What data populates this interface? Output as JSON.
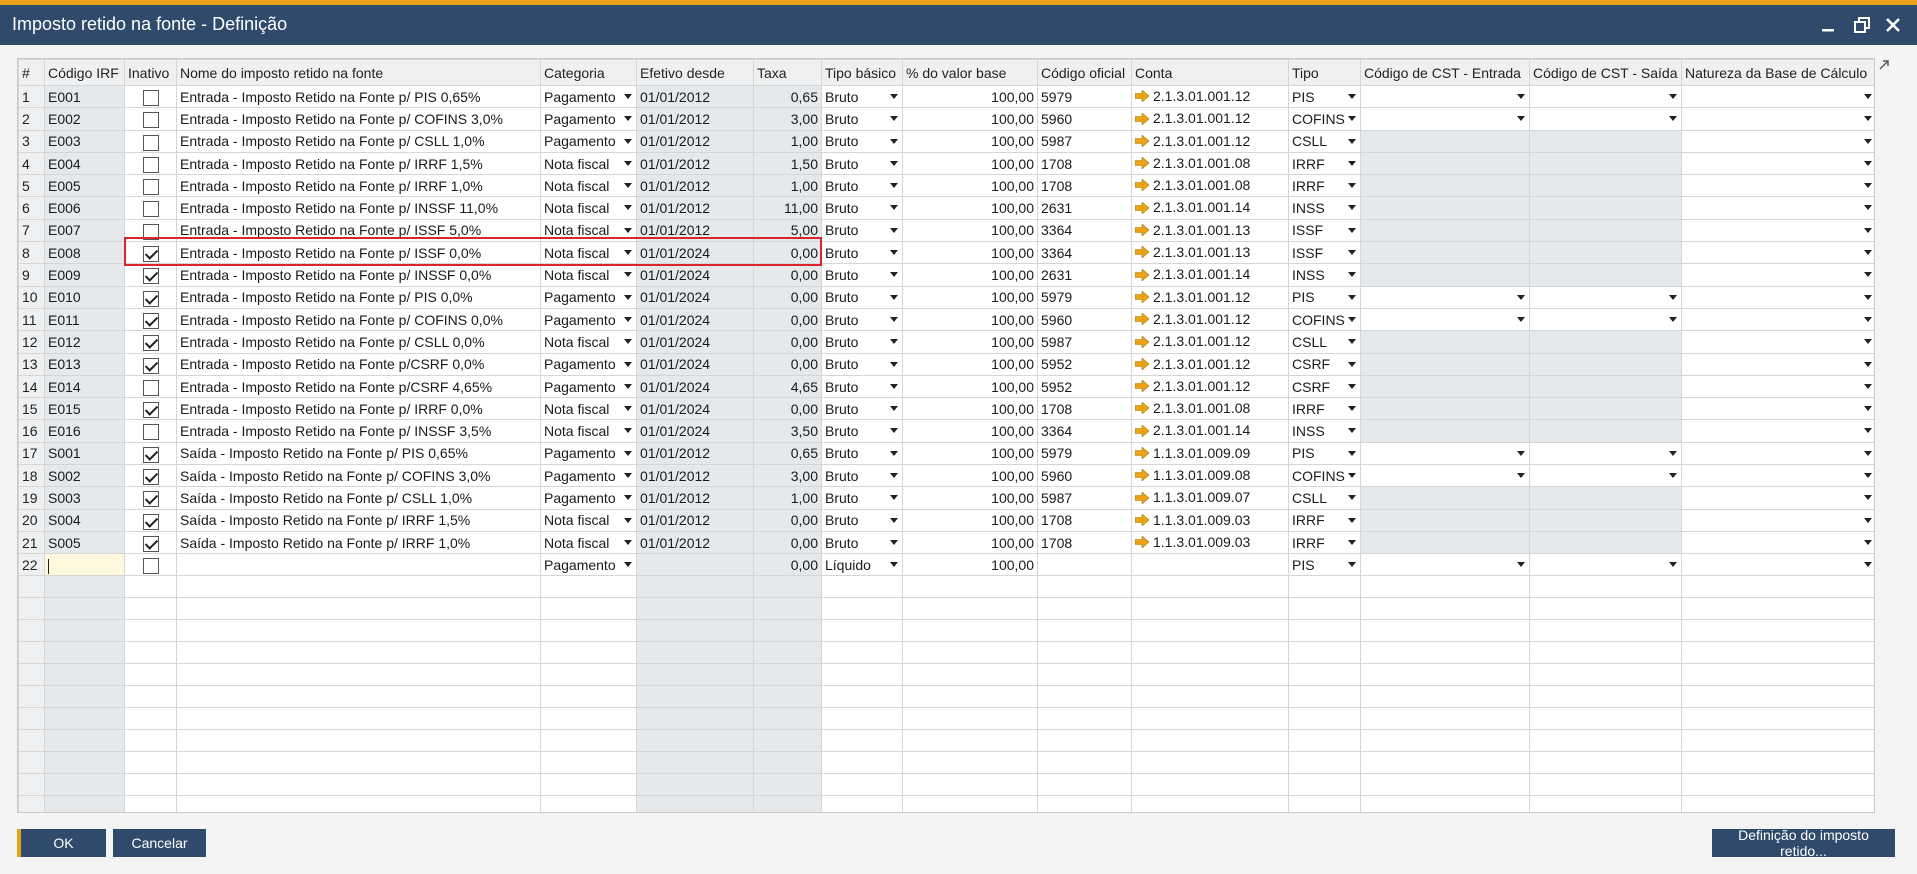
{
  "window": {
    "title": "Imposto retido na fonte - Definição"
  },
  "columns": [
    "#",
    "Código IRF",
    "Inativo",
    "Nome do imposto retido na fonte",
    "Categoria",
    "Efetivo desde",
    "Taxa",
    "Tipo básico",
    "% do valor base",
    "Código oficial",
    "Conta",
    "Tipo",
    "Código de CST - Entrada",
    "Código de CST - Saída",
    "Natureza da Base de Cálculo"
  ],
  "rows": [
    {
      "num": "1",
      "code": "E001",
      "inactive": false,
      "name": "Entrada - Imposto Retido na Fonte p/ PIS 0,65%",
      "category": "Pagamento",
      "date": "01/01/2012",
      "rate": "0,65",
      "basic": "Bruto",
      "pct": "100,00",
      "official": "5979",
      "account": "2.1.3.01.001.12",
      "type": "PIS",
      "cst": "dd"
    },
    {
      "num": "2",
      "code": "E002",
      "inactive": false,
      "name": "Entrada - Imposto Retido na Fonte p/ COFINS 3,0%",
      "category": "Pagamento",
      "date": "01/01/2012",
      "rate": "3,00",
      "basic": "Bruto",
      "pct": "100,00",
      "official": "5960",
      "account": "2.1.3.01.001.12",
      "type": "COFINS",
      "cst": "dd"
    },
    {
      "num": "3",
      "code": "E003",
      "inactive": false,
      "name": "Entrada - Imposto Retido na Fonte p/ CSLL 1,0%",
      "category": "Pagamento",
      "date": "01/01/2012",
      "rate": "1,00",
      "basic": "Bruto",
      "pct": "100,00",
      "official": "5987",
      "account": "2.1.3.01.001.12",
      "type": "CSLL",
      "cst": "gray"
    },
    {
      "num": "4",
      "code": "E004",
      "inactive": false,
      "name": "Entrada - Imposto Retido na Fonte p/ IRRF 1,5%",
      "category": "Nota fiscal",
      "date": "01/01/2012",
      "rate": "1,50",
      "basic": "Bruto",
      "pct": "100,00",
      "official": "1708",
      "account": "2.1.3.01.001.08",
      "type": "IRRF",
      "cst": "gray"
    },
    {
      "num": "5",
      "code": "E005",
      "inactive": false,
      "name": "Entrada - Imposto Retido na Fonte p/ IRRF 1,0%",
      "category": "Nota fiscal",
      "date": "01/01/2012",
      "rate": "1,00",
      "basic": "Bruto",
      "pct": "100,00",
      "official": "1708",
      "account": "2.1.3.01.001.08",
      "type": "IRRF",
      "cst": "gray"
    },
    {
      "num": "6",
      "code": "E006",
      "inactive": false,
      "name": "Entrada - Imposto Retido na Fonte p/ INSSF 11,0%",
      "category": "Nota fiscal",
      "date": "01/01/2012",
      "rate": "11,00",
      "basic": "Bruto",
      "pct": "100,00",
      "official": "2631",
      "account": "2.1.3.01.001.14",
      "type": "INSS",
      "cst": "gray"
    },
    {
      "num": "7",
      "code": "E007",
      "inactive": false,
      "name": "Entrada - Imposto Retido na Fonte p/ ISSF 5,0%",
      "category": "Nota fiscal",
      "date": "01/01/2012",
      "rate": "5,00",
      "basic": "Bruto",
      "pct": "100,00",
      "official": "3364",
      "account": "2.1.3.01.001.13",
      "type": "ISSF",
      "cst": "gray"
    },
    {
      "num": "8",
      "code": "E008",
      "inactive": true,
      "name": "Entrada - Imposto Retido na Fonte p/ ISSF 0,0%",
      "category": "Nota fiscal",
      "date": "01/01/2024",
      "rate": "0,00",
      "basic": "Bruto",
      "pct": "100,00",
      "official": "3364",
      "account": "2.1.3.01.001.13",
      "type": "ISSF",
      "cst": "gray"
    },
    {
      "num": "9",
      "code": "E009",
      "inactive": true,
      "name": "Entrada - Imposto Retido na Fonte p/ INSSF 0,0%",
      "category": "Nota fiscal",
      "date": "01/01/2024",
      "rate": "0,00",
      "basic": "Bruto",
      "pct": "100,00",
      "official": "2631",
      "account": "2.1.3.01.001.14",
      "type": "INSS",
      "cst": "gray"
    },
    {
      "num": "10",
      "code": "E010",
      "inactive": true,
      "name": "Entrada - Imposto Retido na Fonte p/ PIS 0,0%",
      "category": "Pagamento",
      "date": "01/01/2024",
      "rate": "0,00",
      "basic": "Bruto",
      "pct": "100,00",
      "official": "5979",
      "account": "2.1.3.01.001.12",
      "type": "PIS",
      "cst": "dd"
    },
    {
      "num": "11",
      "code": "E011",
      "inactive": true,
      "name": "Entrada - Imposto Retido na Fonte p/ COFINS 0,0%",
      "category": "Pagamento",
      "date": "01/01/2024",
      "rate": "0,00",
      "basic": "Bruto",
      "pct": "100,00",
      "official": "5960",
      "account": "2.1.3.01.001.12",
      "type": "COFINS",
      "cst": "dd"
    },
    {
      "num": "12",
      "code": "E012",
      "inactive": true,
      "name": "Entrada - Imposto Retido na Fonte p/ CSLL 0,0%",
      "category": "Nota fiscal",
      "date": "01/01/2024",
      "rate": "0,00",
      "basic": "Bruto",
      "pct": "100,00",
      "official": "5987",
      "account": "2.1.3.01.001.12",
      "type": "CSLL",
      "cst": "gray"
    },
    {
      "num": "13",
      "code": "E013",
      "inactive": true,
      "name": "Entrada - Imposto Retido na Fonte p/CSRF  0,0%",
      "category": "Pagamento",
      "date": "01/01/2024",
      "rate": "0,00",
      "basic": "Bruto",
      "pct": "100,00",
      "official": "5952",
      "account": "2.1.3.01.001.12",
      "type": "CSRF",
      "cst": "gray"
    },
    {
      "num": "14",
      "code": "E014",
      "inactive": false,
      "name": "Entrada - Imposto Retido na Fonte p/CSRF  4,65%",
      "category": "Pagamento",
      "date": "01/01/2024",
      "rate": "4,65",
      "basic": "Bruto",
      "pct": "100,00",
      "official": "5952",
      "account": "2.1.3.01.001.12",
      "type": "CSRF",
      "cst": "gray"
    },
    {
      "num": "15",
      "code": "E015",
      "inactive": true,
      "name": "Entrada - Imposto Retido na Fonte p/ IRRF 0,0%",
      "category": "Nota fiscal",
      "date": "01/01/2024",
      "rate": "0,00",
      "basic": "Bruto",
      "pct": "100,00",
      "official": "1708",
      "account": "2.1.3.01.001.08",
      "type": "IRRF",
      "cst": "gray"
    },
    {
      "num": "16",
      "code": "E016",
      "inactive": false,
      "name": "Entrada - Imposto Retido na Fonte p/ INSSF 3,5%",
      "category": "Nota fiscal",
      "date": "01/01/2024",
      "rate": "3,50",
      "basic": "Bruto",
      "pct": "100,00",
      "official": "3364",
      "account": "2.1.3.01.001.14",
      "type": "INSS",
      "cst": "gray"
    },
    {
      "num": "17",
      "code": "S001",
      "inactive": true,
      "name": "Saída - Imposto Retido na Fonte p/ PIS 0,65%",
      "category": "Pagamento",
      "date": "01/01/2012",
      "rate": "0,65",
      "basic": "Bruto",
      "pct": "100,00",
      "official": "5979",
      "account": "1.1.3.01.009.09",
      "type": "PIS",
      "cst": "dd"
    },
    {
      "num": "18",
      "code": "S002",
      "inactive": true,
      "name": "Saída - Imposto Retido na Fonte p/ COFINS 3,0%",
      "category": "Pagamento",
      "date": "01/01/2012",
      "rate": "3,00",
      "basic": "Bruto",
      "pct": "100,00",
      "official": "5960",
      "account": "1.1.3.01.009.08",
      "type": "COFINS",
      "cst": "dd"
    },
    {
      "num": "19",
      "code": "S003",
      "inactive": true,
      "name": "Saída - Imposto Retido na Fonte p/ CSLL 1,0%",
      "category": "Pagamento",
      "date": "01/01/2012",
      "rate": "1,00",
      "basic": "Bruto",
      "pct": "100,00",
      "official": "5987",
      "account": "1.1.3.01.009.07",
      "type": "CSLL",
      "cst": "gray"
    },
    {
      "num": "20",
      "code": "S004",
      "inactive": true,
      "name": "Saída - Imposto Retido na Fonte p/ IRRF 1,5%",
      "category": "Nota fiscal",
      "date": "01/01/2012",
      "rate": "0,00",
      "basic": "Bruto",
      "pct": "100,00",
      "official": "1708",
      "account": "1.1.3.01.009.03",
      "type": "IRRF",
      "cst": "gray"
    },
    {
      "num": "21",
      "code": "S005",
      "inactive": true,
      "name": "Saída - Imposto Retido na Fonte p/ IRRF 1,0%",
      "category": "Nota fiscal",
      "date": "01/01/2012",
      "rate": "0,00",
      "basic": "Bruto",
      "pct": "100,00",
      "official": "1708",
      "account": "1.1.3.01.009.03",
      "type": "IRRF",
      "cst": "gray"
    },
    {
      "num": "22",
      "code": "",
      "inactive": false,
      "name": "",
      "category": "Pagamento",
      "date": "",
      "rate": "0,00",
      "basic": "Líquido",
      "pct": "100,00",
      "official": "",
      "account": "",
      "type": "PIS",
      "cst": "dd",
      "newRow": true
    }
  ],
  "empty_row_count": 11,
  "buttons": {
    "ok": "OK",
    "cancel": "Cancelar",
    "definition": "Definição do imposto retido..."
  },
  "colors": {
    "titlebar": "#2f4a6a",
    "accent": "#e8a317",
    "highlight": "#d9262c",
    "arrow": "#e8a317"
  }
}
